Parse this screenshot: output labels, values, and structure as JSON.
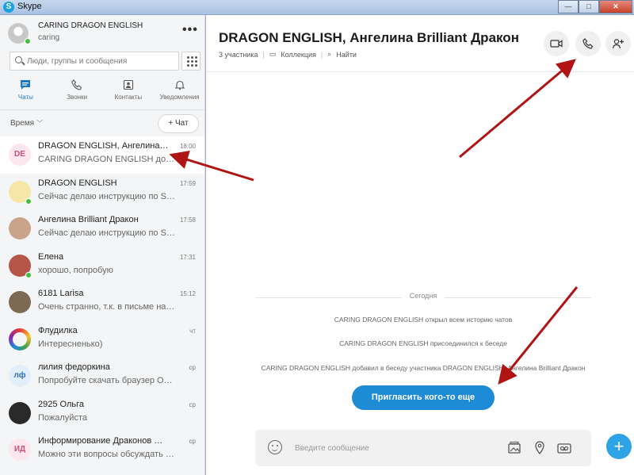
{
  "window": {
    "title": "Skype"
  },
  "profile": {
    "name": "CARING DRAGON ENGLISH",
    "status": "caring",
    "more": "•••"
  },
  "search": {
    "placeholder": "Люди, группы и сообщения"
  },
  "nav": [
    {
      "label": "Чаты",
      "icon": "chat-icon",
      "active": true
    },
    {
      "label": "Звонки",
      "icon": "phone-icon"
    },
    {
      "label": "Контакты",
      "icon": "contacts-icon"
    },
    {
      "label": "Уведомления",
      "icon": "bell-icon"
    }
  ],
  "sort": {
    "label": "Время",
    "new_chat": "Чат"
  },
  "chats": [
    {
      "name": "DRAGON ENGLISH, Ангелина Brilliant Дракон",
      "message": "CARING DRAGON ENGLISH добавил в беседу",
      "time": "18:00",
      "initials": "DE",
      "avatar_bg": "#fde7ee",
      "avatar_fg": "#c8507a"
    },
    {
      "name": "DRAGON ENGLISH",
      "message": "Сейчас делаю инструкцию по Skype",
      "time": "17:59",
      "initials": "",
      "avatar_bg": "#f6e7a8"
    },
    {
      "name": "Ангелина Brilliant Дракон",
      "message": "Сейчас делаю инструкцию по Skype",
      "time": "17:58",
      "initials": "",
      "avatar_bg": "#caa48a"
    },
    {
      "name": "Елена",
      "message": "хорошо, попробую",
      "time": "17:31",
      "initials": "",
      "avatar_bg": "#b5564a"
    },
    {
      "name": "6181 Larisa",
      "message": "Очень странно, т.к. в письме написано",
      "time": "15:12",
      "initials": "",
      "avatar_bg": "#7d6a55"
    },
    {
      "name": "Флудилка",
      "message": "Интересненько)",
      "time": "чт",
      "initials": "",
      "avatar_bg": "ring"
    },
    {
      "name": "лилия федоркина",
      "message": "Попробуйте скачать браузер Opera",
      "time": "ср",
      "initials": "лф",
      "avatar_bg": "#e3eefb",
      "avatar_fg": "#2f6eb5"
    },
    {
      "name": "2925 Ольга",
      "message": "Пожалуйста",
      "time": "ср",
      "initials": "",
      "avatar_bg": "#2a2a2a"
    },
    {
      "name": "Информирование Драконов Dragon English",
      "message": "Можно эти вопросы обсуждать в группе",
      "time": "ср",
      "initials": "ИД",
      "avatar_bg": "#fde7ee",
      "avatar_fg": "#c8507a"
    }
  ],
  "conversation": {
    "title": "DRAGON ENGLISH, Ангелина Brilliant Дракон",
    "participants": "3 участника",
    "collection": "Коллекция",
    "find": "Найти",
    "day": "Сегодня",
    "events": [
      "CARING DRAGON ENGLISH открыл всем историю чатов",
      "CARING DRAGON ENGLISH присоединился к беседе",
      "CARING DRAGON ENGLISH добавил в беседу участника DRAGON ENGLISH, Ангелина Brilliant Дракон"
    ],
    "invite": "Пригласить кого-то еще",
    "composer_placeholder": "Введите сообщение"
  },
  "colors": {
    "accent": "#1e8bd6",
    "annotation": "#b01414",
    "presence": "#3fbf3f"
  }
}
